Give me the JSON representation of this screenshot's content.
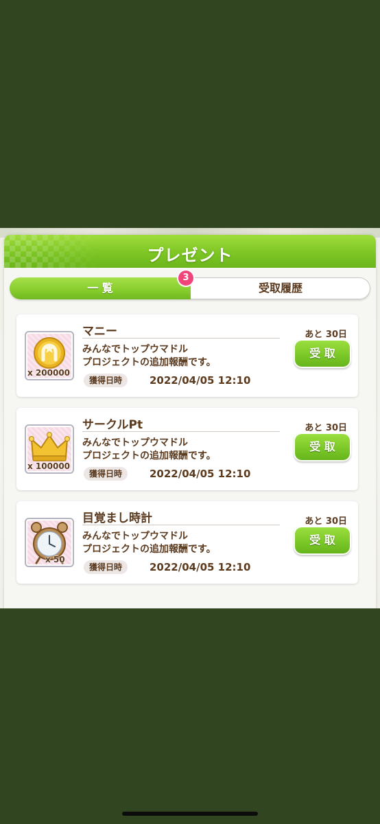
{
  "header": {
    "title": "プレゼント"
  },
  "tabs": [
    {
      "label": "一 覧",
      "active": true,
      "badge": "3"
    },
    {
      "label": "受取履歴",
      "active": false
    }
  ],
  "items": [
    {
      "name": "マニー",
      "icon": "horseshoe-coin-icon",
      "quantity": "x 200000",
      "desc_line1": "みんなでトップウマドル",
      "desc_line2": "プロジェクトの追加報酬です。",
      "date_label": "獲得日時",
      "date": "2022/04/05 12:10",
      "remaining": "あと 30日",
      "button": "受 取"
    },
    {
      "name": "サークルPt",
      "icon": "crown-icon",
      "quantity": "x 100000",
      "desc_line1": "みんなでトップウマドル",
      "desc_line2": "プロジェクトの追加報酬です。",
      "date_label": "獲得日時",
      "date": "2022/04/05 12:10",
      "remaining": "あと 30日",
      "button": "受 取"
    },
    {
      "name": "目覚まし時計",
      "icon": "alarm-clock-icon",
      "quantity": "x 50",
      "desc_line1": "みんなでトップウマドル",
      "desc_line2": "プロジェクトの追加報酬です。",
      "date_label": "獲得日時",
      "date": "2022/04/05 12:10",
      "remaining": "あと 30日",
      "button": "受 取"
    }
  ],
  "colors": {
    "outer_background": "#314520",
    "accent_green": "#7dc624",
    "badge_pink": "#f0457a",
    "text_brown": "#5b3a1e"
  }
}
